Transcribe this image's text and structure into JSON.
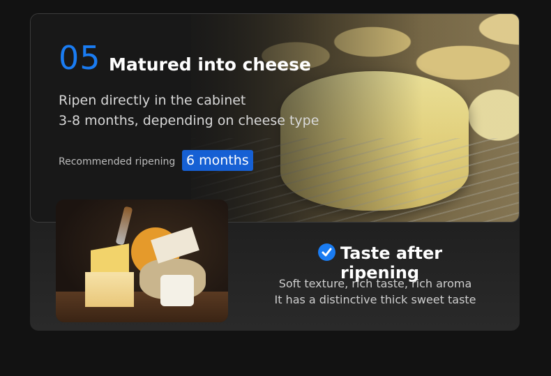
{
  "step": {
    "number": "05",
    "title": "Matured into cheese",
    "description_line1": "Ripen directly in the cabinet",
    "description_line2": "3-8 months, depending on cheese type",
    "recommended_label": "Recommended ripening",
    "recommended_value": "6 months"
  },
  "taste": {
    "title": "Taste after ripening",
    "line1": "Soft texture, rich taste, rich aroma",
    "line2": "It has a distinctive thick sweet taste"
  },
  "colors": {
    "accent": "#1a7cf2",
    "badge": "#1660d4",
    "background": "#121212"
  },
  "icons": [
    "check-circle-icon"
  ]
}
